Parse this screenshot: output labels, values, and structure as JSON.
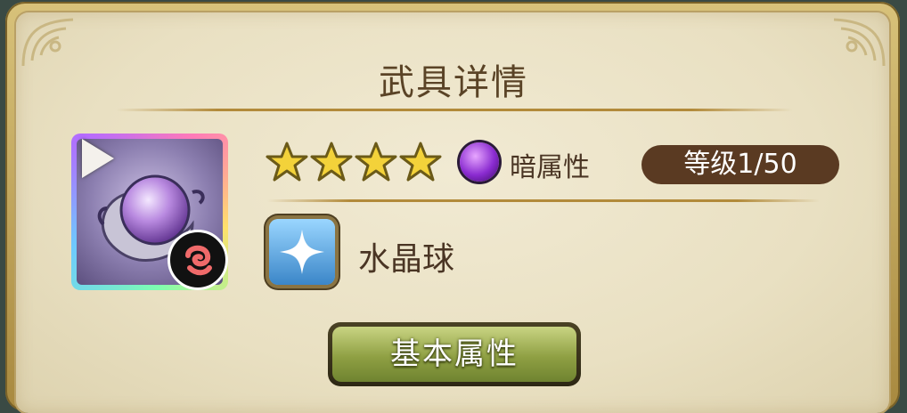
{
  "header": {
    "title": "武具详情"
  },
  "weapon": {
    "rarity_stars": 4,
    "element_label": "暗属性",
    "level_text": "等级1/50",
    "name": "水晶球",
    "icons": {
      "item": "crystal-ball-icon",
      "play": "play-icon",
      "badge": "red-swirl-badge-icon",
      "type": "sparkle-star-icon",
      "element": "dark-orb-icon"
    }
  },
  "actions": {
    "basic_attributes_label": "基本属性"
  },
  "colors": {
    "title_text": "#5a4326",
    "panel_bg": "#ece3c6",
    "level_pill": "#5a3a22",
    "button_green": "#8fa043",
    "star_gold": "#f3d23a",
    "element_purple": "#8a2bd0"
  }
}
